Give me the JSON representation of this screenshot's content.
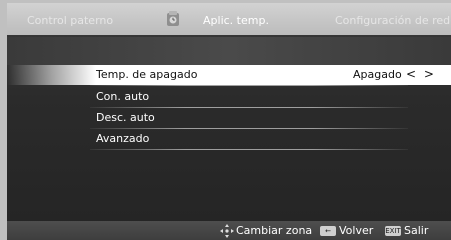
{
  "tabs": {
    "left": "Control paterno",
    "active": "Aplic. temp.",
    "right": "Configuración de red"
  },
  "icons": {
    "tab_icon": "timer-app-icon",
    "nav": "four-way-arrows-icon",
    "back": "back-key-icon",
    "exit": "exit-key-icon"
  },
  "menu": {
    "items": [
      {
        "label": "Temp. de apagado",
        "value": "Apagado",
        "selected": true
      },
      {
        "label": "Con. auto"
      },
      {
        "label": "Desc. auto"
      },
      {
        "label": "Avanzado"
      }
    ],
    "arrows": "< >"
  },
  "footer": {
    "change_zone": "Cambiar zona",
    "back": "Volver",
    "exit_key": "EXIT",
    "exit": "Salir"
  },
  "colors": {
    "panel": "#2b2b2b",
    "selected_row": "#ffffff",
    "tab_bar": "#c8c8c8"
  }
}
